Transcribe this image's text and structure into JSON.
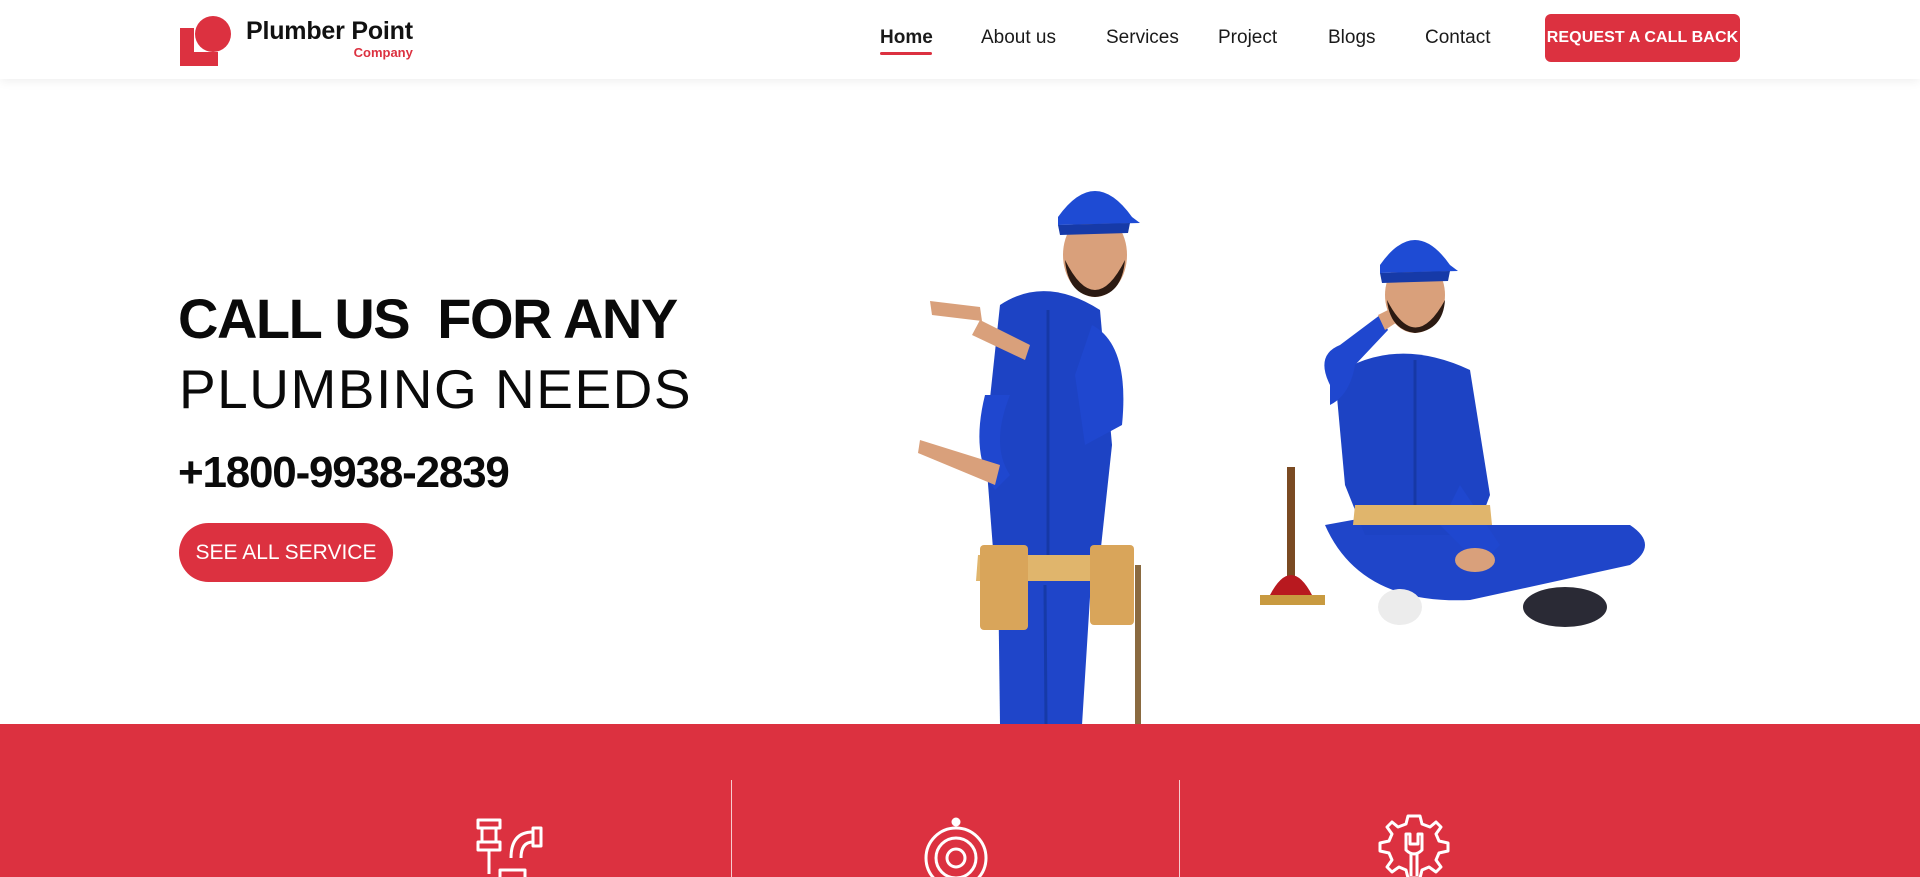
{
  "brand": {
    "name": "Plumber Point",
    "tagline": "Company",
    "accent": "#dc3140"
  },
  "nav": {
    "items": [
      {
        "label": "Home",
        "active": true
      },
      {
        "label": "About us",
        "active": false
      },
      {
        "label": "Services",
        "active": false
      },
      {
        "label": "Project",
        "active": false
      },
      {
        "label": "Blogs",
        "active": false
      },
      {
        "label": "Contact",
        "active": false
      }
    ],
    "cta_label": "REQUEST A CALL BACK"
  },
  "hero": {
    "headline_bold": "CALL US  FOR ANY",
    "headline_light": "PLUMBING NEEDS",
    "phone": "+1800-9938-2839",
    "button_label": "SEE ALL SERVICE",
    "image": "two-plumbers-in-blue-overalls"
  },
  "features": {
    "icons": [
      "pipes-icon",
      "gear-icon",
      "wrench-gear-icon"
    ]
  }
}
